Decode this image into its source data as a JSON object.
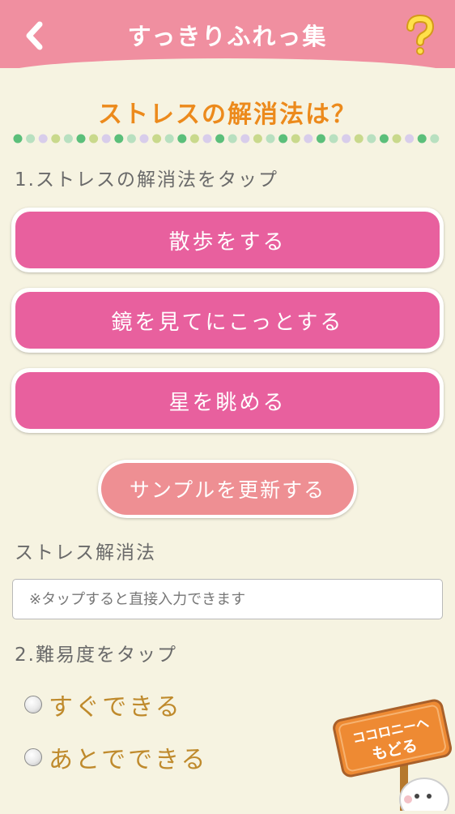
{
  "header": {
    "title": "すっきりふれっ集",
    "back_icon": "chevron-left-icon",
    "help_icon": "question-mark-icon"
  },
  "question": "ストレスの解消法は？",
  "step1": {
    "label": "1.ストレスの解消法をタップ",
    "options": [
      "散歩をする",
      "鏡を見てにこっとする",
      "星を眺める"
    ]
  },
  "sample_button": "サンプルを更新する",
  "stress_field": {
    "label": "ストレス解消法",
    "value": "",
    "placeholder": "※タップすると直接入力できます"
  },
  "step2": {
    "label": "2.難易度をタップ",
    "options": [
      "すぐできる",
      "あとでできる"
    ]
  },
  "return_sign": {
    "line1": "ココロニーへ",
    "line2": "もどる"
  },
  "colors": {
    "header": "#f08fa0",
    "option_button": "#e8609e",
    "sample_button": "#ee8f93",
    "question_text": "#ec8a1c",
    "radio_label": "#bf8a2c",
    "background": "#f6f3e1"
  }
}
